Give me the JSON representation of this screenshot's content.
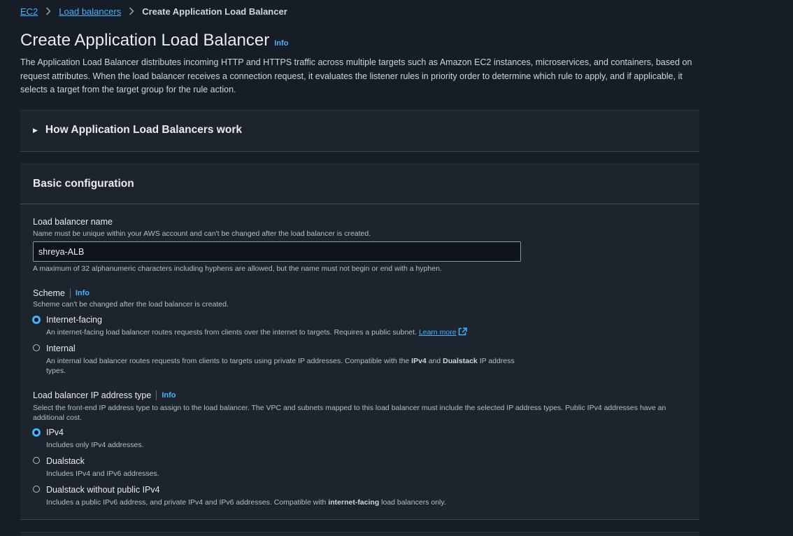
{
  "breadcrumb": {
    "items": [
      "EC2",
      "Load balancers"
    ],
    "current": "Create Application Load Balancer"
  },
  "page": {
    "title": "Create Application Load Balancer",
    "info": "Info",
    "description": "The Application Load Balancer distributes incoming HTTP and HTTPS traffic across multiple targets such as Amazon EC2 instances, microservices, and containers, based on request attributes. When the load balancer receives a connection request, it evaluates the listener rules in priority order to determine which rule to apply, and if applicable, it selects a target from the target group for the rule action."
  },
  "expand_section": {
    "label": "How Application Load Balancers work"
  },
  "basic_config": {
    "title": "Basic configuration",
    "name_field": {
      "label": "Load balancer name",
      "description": "Name must be unique within your AWS account and can't be changed after the load balancer is created.",
      "value": "shreya-ALB",
      "constraint": "A maximum of 32 alphanumeric characters including hyphens are allowed, but the name must not begin or end with a hyphen."
    },
    "scheme": {
      "label": "Scheme",
      "info": "Info",
      "description": "Scheme can't be changed after the load balancer is created.",
      "options": [
        {
          "label": "Internet-facing",
          "description": "An internet-facing load balancer routes requests from clients over the internet to targets. Requires a public subnet.",
          "link": "Learn more",
          "checked": true
        },
        {
          "label": "Internal",
          "desc_part1": "An internal load balancer routes requests from clients to targets using private IP addresses. Compatible with the",
          "bold1": "IPv4",
          "desc_part2": "and",
          "bold2": "Dualstack",
          "desc_part3": "IP address types.",
          "checked": false
        }
      ]
    },
    "ip_type": {
      "label": "Load balancer IP address type",
      "info": "Info",
      "description": "Select the front-end IP address type to assign to the load balancer. The VPC and subnets mapped to this load balancer must include the selected IP address types. Public IPv4 addresses have an additional cost.",
      "options": [
        {
          "label": "IPv4",
          "description": "Includes only IPv4 addresses.",
          "checked": true
        },
        {
          "label": "Dualstack",
          "description": "Includes IPv4 and IPv6 addresses.",
          "checked": false
        },
        {
          "label": "Dualstack without public IPv4",
          "desc_part1": "Includes a public IPv6 address, and private IPv4 and IPv6 addresses. Compatible with",
          "bold": "internet-facing",
          "desc_part2": "load balancers only.",
          "checked": false
        }
      ]
    }
  },
  "colors": {
    "background": "#161d26",
    "container": "#1e242d",
    "accent": "#42b4ff",
    "text": "#d1d5db"
  }
}
